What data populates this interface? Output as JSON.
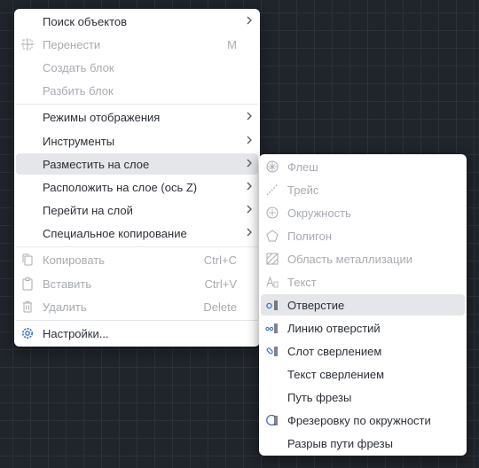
{
  "context_menu": {
    "items": [
      {
        "label": "Поиск объектов",
        "has_submenu": true,
        "enabled": true
      },
      {
        "label": "Перенести",
        "shortcut": "M",
        "icon": "move-icon",
        "enabled": false
      },
      {
        "label": "Создать блок",
        "enabled": false
      },
      {
        "label": "Разбить блок",
        "enabled": false
      },
      {
        "label": "Режимы отображения",
        "has_submenu": true,
        "enabled": true
      },
      {
        "label": "Инструменты",
        "has_submenu": true,
        "enabled": true
      },
      {
        "label": "Разместить на слое",
        "has_submenu": true,
        "enabled": true,
        "highlighted": true
      },
      {
        "label": "Расположить на слое (ось Z)",
        "has_submenu": true,
        "enabled": true
      },
      {
        "label": "Перейти на слой",
        "has_submenu": true,
        "enabled": true
      },
      {
        "label": "Специальное копирование",
        "has_submenu": true,
        "enabled": true
      },
      {
        "label": "Копировать",
        "shortcut": "Ctrl+C",
        "icon": "copy-icon",
        "enabled": false
      },
      {
        "label": "Вставить",
        "shortcut": "Ctrl+V",
        "icon": "paste-icon",
        "enabled": false
      },
      {
        "label": "Удалить",
        "shortcut": "Delete",
        "icon": "trash-icon",
        "enabled": false
      },
      {
        "label": "Настройки...",
        "icon": "gear-icon",
        "enabled": true
      }
    ]
  },
  "submenu": {
    "items": [
      {
        "label": "Флеш",
        "icon": "flash-icon",
        "enabled": false
      },
      {
        "label": "Трейс",
        "icon": "trace-icon",
        "enabled": false
      },
      {
        "label": "Окружность",
        "icon": "circle-icon",
        "enabled": false
      },
      {
        "label": "Полигон",
        "icon": "polygon-icon",
        "enabled": false
      },
      {
        "label": "Область металлизации",
        "icon": "hatch-area-icon",
        "enabled": false
      },
      {
        "label": "Текст",
        "icon": "text-icon",
        "enabled": false
      },
      {
        "label": "Отверстие",
        "icon": "hole-icon",
        "enabled": true,
        "highlighted": true
      },
      {
        "label": "Линию отверстий",
        "icon": "hole-line-icon",
        "enabled": true
      },
      {
        "label": "Слот сверлением",
        "icon": "drill-slot-icon",
        "enabled": true
      },
      {
        "label": "Текст сверлением",
        "enabled": true
      },
      {
        "label": "Путь фрезы",
        "enabled": true
      },
      {
        "label": "Фрезеровку по окружности",
        "icon": "circular-milling-icon",
        "enabled": true
      },
      {
        "label": "Разрыв пути фрезы",
        "enabled": true
      }
    ]
  },
  "colors": {
    "background": "#20242b",
    "menu": "#ffffff",
    "highlight": "#e4e6e9",
    "text": "#2b2f36",
    "disabled": "#a7abb1",
    "accent": "#3a6fd8"
  }
}
